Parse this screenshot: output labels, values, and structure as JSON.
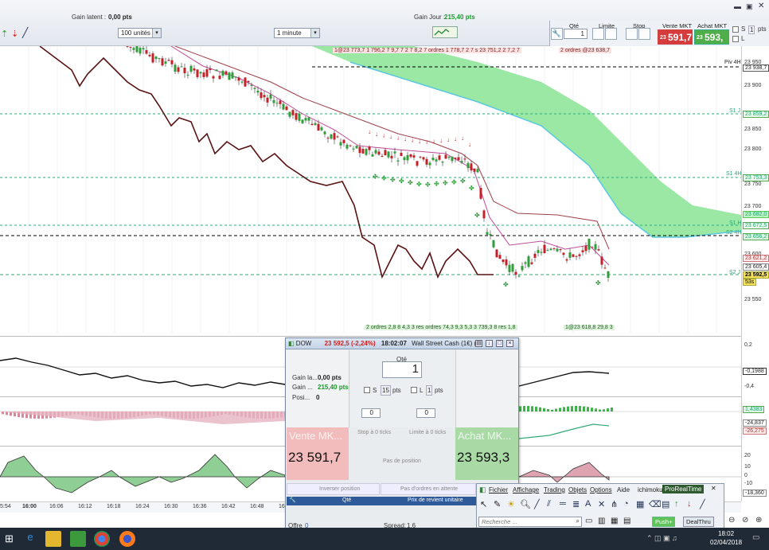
{
  "topbar": {
    "gain_latent_label": "Gain latent :",
    "gain_latent_value": "0,00 pts",
    "gain_jour_label": "Gain Jour :",
    "gain_jour_value": "215,40 pts",
    "units_value": "100 unités",
    "interval_value": "1 minute",
    "qty_header": "Qté",
    "qty_value": "1",
    "limite_header": "Limite",
    "stop_header": "Stop",
    "vente_header": "Vente MKT",
    "achat_header": "Achat MKT",
    "vente_small": "23",
    "vente_big": "591,7",
    "achat_small": "23",
    "achat_big": "593,",
    "s_label": "S",
    "l_label": "L",
    "pts_label": "pts",
    "pts_value": "1"
  },
  "chart": {
    "annotation_top_left": "1@23 773,7 1 796,2 7 9,7 7 2 7 8,2 7 ordres 1 778,7 2 7 s 23 751,2 2 7,2 7",
    "annotation_top_right": "2 ordres @23 638,7",
    "annotation_bottom_left": "2 ordres 2,8 8 4,3 3 res ordres 74,3 9,3 5,3 3 739,3 8 res 1,8",
    "annotation_bottom_right": "1@23 618,8 29,8 3",
    "level_piv": "Piv 4H",
    "level_s1j": "S1 J",
    "level_s14h": "S1 4H",
    "level_s1h": "S1 H",
    "level_s24h": "S2 4H",
    "level_s2": "S2 J"
  },
  "price_axis": {
    "ticks": [
      "23 950",
      "23 900",
      "23 850",
      "23 800",
      "23 750",
      "23 700",
      "23 650",
      "23 600",
      "23 550"
    ],
    "labels": {
      "piv": "23 938,7",
      "s1j": "23 859,2",
      "s14h": "23 753,3",
      "green1": "23 682,0",
      "s1h": "23 672,5",
      "green2": "23 656,2",
      "p1": "23 621,2",
      "p2": "23 605,4",
      "last": "23 592,5",
      "timer": "53s"
    },
    "ind1_ticks": [
      "0,2",
      "-0,1988",
      "-0,4"
    ],
    "ind2_ticks": [
      "1,4383",
      "-24,837",
      "-26,275"
    ],
    "ind3_ticks": [
      "20",
      "10",
      "0",
      "-10",
      "-18,360"
    ]
  },
  "time_axis": [
    "5:54",
    "16:00",
    "16:06",
    "16:12",
    "16:18",
    "16:24",
    "16:30",
    "16:36",
    "16:42",
    "16:48",
    "16:54"
  ],
  "order_window": {
    "title_instrument": "DOW",
    "title_price": "23 592,5 (-2,24%)",
    "title_time": "18:02:07",
    "title_name": "Wall Street Cash (1€) (-)",
    "gain_latent_label": "Gain la...",
    "gain_latent_value": "0,00 pts",
    "gain_label": "Gain ...",
    "gain_value": "215,40 pts",
    "position_label": "Posi...",
    "position_value": "0",
    "qty_label": "Qté",
    "qty_value": "1",
    "s_label": "S",
    "s_value": "15",
    "l_label": "L",
    "l_value": "1",
    "pts_label": "pts",
    "spin_left": "0",
    "spin_right": "0",
    "stop_ticks": "Stop à 0 ticks",
    "limit_ticks": "Limite à 0 ticks",
    "sell_label": "Vente MK...",
    "sell_price": "23 591,7",
    "buy_label": "Achat MK...",
    "buy_price": "23 593,3",
    "no_position": "Pas de position",
    "invert_position": "Inverser position",
    "no_orders": "Pas d'ordres en attente",
    "col_qty": "Qté",
    "col_price": "Prix de revient unitaire",
    "offer_label": "Offre",
    "offer_value": "0",
    "spread_label": "Spread:",
    "spread_value": "1,6"
  },
  "main_menu": {
    "items": [
      "Fichier",
      "Affichage",
      "Trading",
      "Objets",
      "Options",
      "Aide",
      "ichimoku"
    ],
    "brand": "ProRealTime",
    "search_placeholder": "Recherche ...",
    "push_label": "Push+",
    "dealthru_label": "DealThru"
  },
  "taskbar": {
    "time": "18:02",
    "date": "02/04/2018"
  },
  "colors": {
    "bull": "#2e9e3a",
    "bear": "#c4202a",
    "cloud": "#8fe59a",
    "cloud_edge": "#5cc8e0",
    "black_line": "#5a1212",
    "ma_line": "#a0404a"
  }
}
